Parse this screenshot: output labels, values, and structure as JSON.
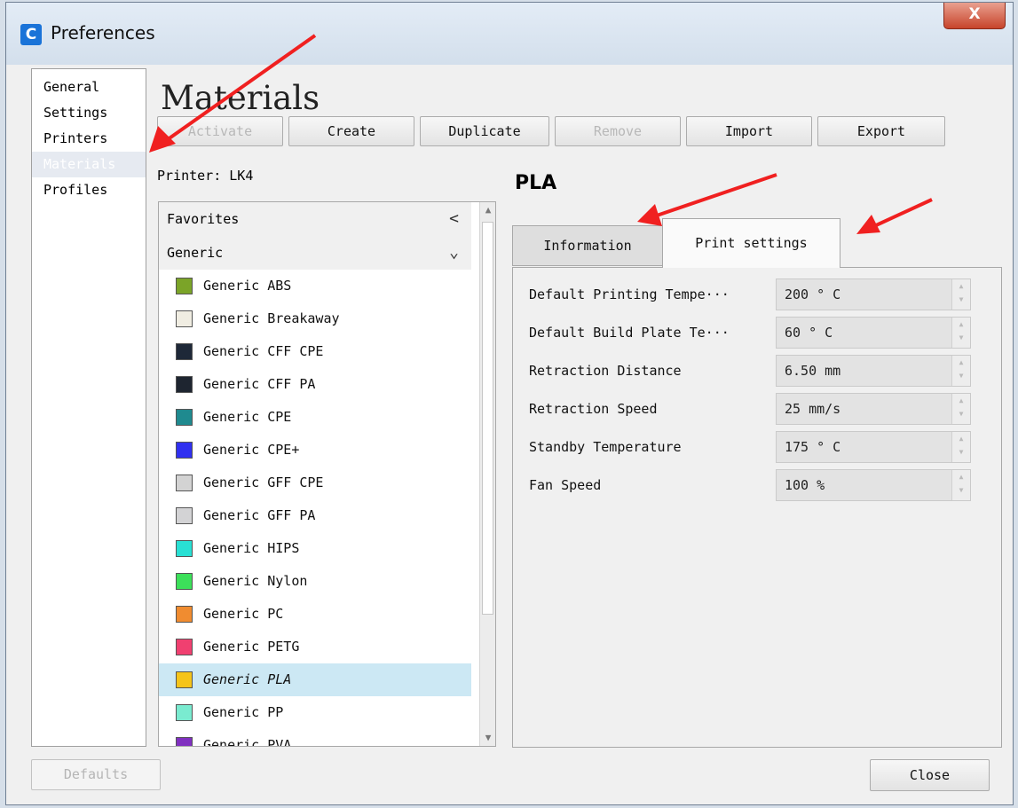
{
  "window": {
    "title": "Preferences",
    "app_icon_glyph": "C",
    "close_glyph": "X"
  },
  "nav": {
    "items": [
      "General",
      "Settings",
      "Printers",
      "Materials",
      "Profiles"
    ],
    "selected": "Materials"
  },
  "page": {
    "title": "Materials"
  },
  "toolbar": {
    "activate": "Activate",
    "create": "Create",
    "duplicate": "Duplicate",
    "remove": "Remove",
    "import": "Import",
    "export": "Export"
  },
  "printer": {
    "label": "Printer: LK4"
  },
  "list": {
    "favorites_label": "Favorites",
    "favorites_chevron": "<",
    "generic_label": "Generic",
    "generic_chevron": "⌄",
    "materials": [
      {
        "name": "Generic ABS",
        "color": "#7ba428"
      },
      {
        "name": "Generic Breakaway",
        "color": "#f0ede2"
      },
      {
        "name": "Generic CFF CPE",
        "color": "#1e2838"
      },
      {
        "name": "Generic CFF PA",
        "color": "#1e2530"
      },
      {
        "name": "Generic CPE",
        "color": "#1f8a8f"
      },
      {
        "name": "Generic CPE+",
        "color": "#3030f0"
      },
      {
        "name": "Generic GFF CPE",
        "color": "#d3d3d3"
      },
      {
        "name": "Generic GFF PA",
        "color": "#d3d3d5"
      },
      {
        "name": "Generic HIPS",
        "color": "#29e0d4"
      },
      {
        "name": "Generic Nylon",
        "color": "#3ce05a"
      },
      {
        "name": "Generic PC",
        "color": "#f08c30"
      },
      {
        "name": "Generic PETG",
        "color": "#f04070"
      },
      {
        "name": "Generic PLA",
        "color": "#f5c41a"
      },
      {
        "name": "Generic PP",
        "color": "#7aebd0"
      },
      {
        "name": "Generic PVA",
        "color": "#8030c0"
      }
    ],
    "selected_index": 12,
    "scroll_up_glyph": "▲",
    "scroll_down_glyph": "▼"
  },
  "detail": {
    "material_name": "PLA",
    "tabs": [
      "Information",
      "Print settings"
    ],
    "active_tab": "Print settings",
    "settings": [
      {
        "label": "Default Printing Tempe···",
        "value": "200 ° C"
      },
      {
        "label": "Default Build Plate Te···",
        "value": "60 ° C"
      },
      {
        "label": "Retraction Distance",
        "value": "6.50 mm"
      },
      {
        "label": "Retraction Speed",
        "value": "25 mm/s"
      },
      {
        "label": "Standby Temperature",
        "value": "175 ° C"
      },
      {
        "label": "Fan Speed",
        "value": "100 %"
      }
    ],
    "spin_up_glyph": "▲",
    "spin_down_glyph": "▼"
  },
  "footer": {
    "defaults": "Defaults",
    "close": "Close"
  },
  "annotation_color": "#f02020"
}
